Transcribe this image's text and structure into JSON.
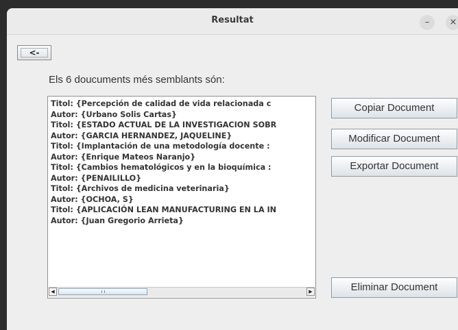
{
  "window": {
    "title": "Resultat",
    "minimize_glyph": "–",
    "close_glyph": "×"
  },
  "back_button": {
    "label": "<-"
  },
  "heading": "Els 6 doucuments més semblants són:",
  "results": [
    "Titol: {Percepción de calidad de vida relacionada c",
    "Autor: {Urbano Solis Cartas}",
    "Titol: {ESTADO ACTUAL DE LA INVESTIGACION SOBR",
    "Autor: {GARCIA HERNANDEZ, JAQUELINE}",
    "Titol: {Implantación de una metodología docente :",
    "Autor: {Enrique Mateos Naranjo}",
    "Titol: {Cambios hematológicos y en la bioquímica :",
    "Autor: {PENAILILLO}",
    "Titol: {Archivos de medicina veterinaria}",
    "Autor: {OCHOA, S}",
    "Titol: {APLICACIÓN LEAN MANUFACTURING EN LA IN",
    "Autor: {Juan Gregorio Arrieta}"
  ],
  "actions": {
    "copy": "Copiar Document",
    "modify": "Modificar Document",
    "export": "Exportar Document",
    "delete": "Eliminar Document"
  },
  "icons": [
    "left-arrow-icon",
    "right-arrow-icon",
    "minimize-icon",
    "close-icon"
  ]
}
